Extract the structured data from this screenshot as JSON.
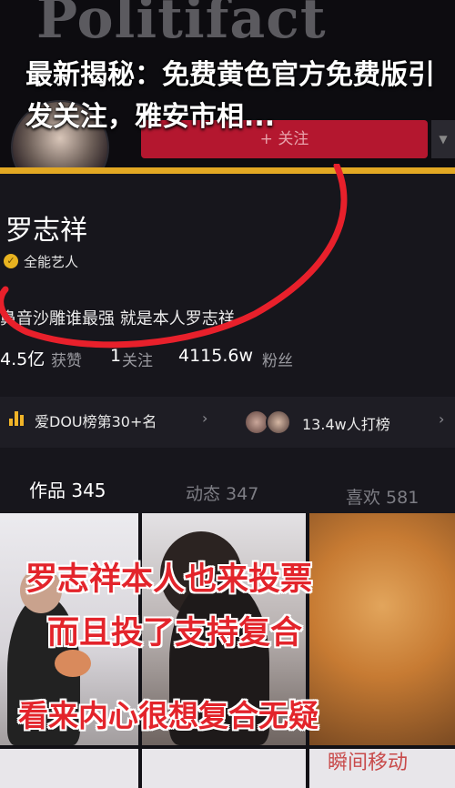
{
  "overlay": {
    "watermark": "Politifact",
    "headline": "最新揭秘：免费黄色官方免费版引发关注，雅安市相..."
  },
  "profile": {
    "follow_button": "+ 关注",
    "dropdown_icon": "chevron-down-icon",
    "name": "罗志祥",
    "badge": "全能艺人",
    "bio": "鼻音沙雕谁最强 就是本人罗志祥",
    "stats": {
      "likes_value": "4.5亿",
      "likes_label": "获赞",
      "following_value": "1",
      "following_label": "关注",
      "fans_value": "4115.6w",
      "fans_label": "粉丝"
    }
  },
  "rank": {
    "text": "爱DOU榜第30+名",
    "arrow": "›",
    "supporters": "13.4w人打榜",
    "arrow2": "›"
  },
  "tabs": [
    {
      "label": "作品 345"
    },
    {
      "label": "动态 347"
    },
    {
      "label": "喜欢 581"
    }
  ],
  "video_caption": {
    "line1": "罗志祥本人也来投票",
    "line2": "而且投了支持复合",
    "line3": "看来内心很想复合无疑",
    "corner": "瞬间移动"
  },
  "colors": {
    "accent_gold": "#e2a823",
    "follow_red": "#b4172f",
    "caption_red": "#e3242b"
  }
}
